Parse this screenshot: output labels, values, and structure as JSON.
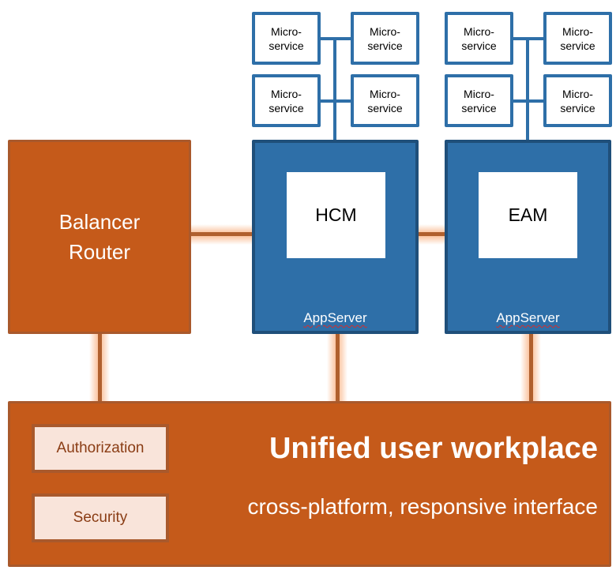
{
  "diagram": {
    "router": {
      "label": "Balancer\nRouter"
    },
    "app_servers": [
      {
        "module": "HCM",
        "label": "AppServer",
        "microservices": [
          "Micro-\nservice",
          "Micro-\nservice",
          "Micro-\nservice",
          "Micro-\nservice"
        ]
      },
      {
        "module": "EAM",
        "label": "AppServer",
        "microservices": [
          "Micro-\nservice",
          "Micro-\nservice",
          "Micro-\nservice",
          "Micro-\nservice"
        ]
      }
    ],
    "workplace": {
      "title": "Unified user workplace",
      "subtitle": "cross-platform, responsive interface",
      "components": [
        "Authorization",
        "Security"
      ]
    },
    "colors": {
      "orange_fill": "#c55a1a",
      "orange_border": "#a9592c",
      "blue_fill": "#2e6fa8",
      "blue_border": "#1f4f7a",
      "pill_fill": "#f9e4da",
      "glow": "#fabe96"
    }
  }
}
